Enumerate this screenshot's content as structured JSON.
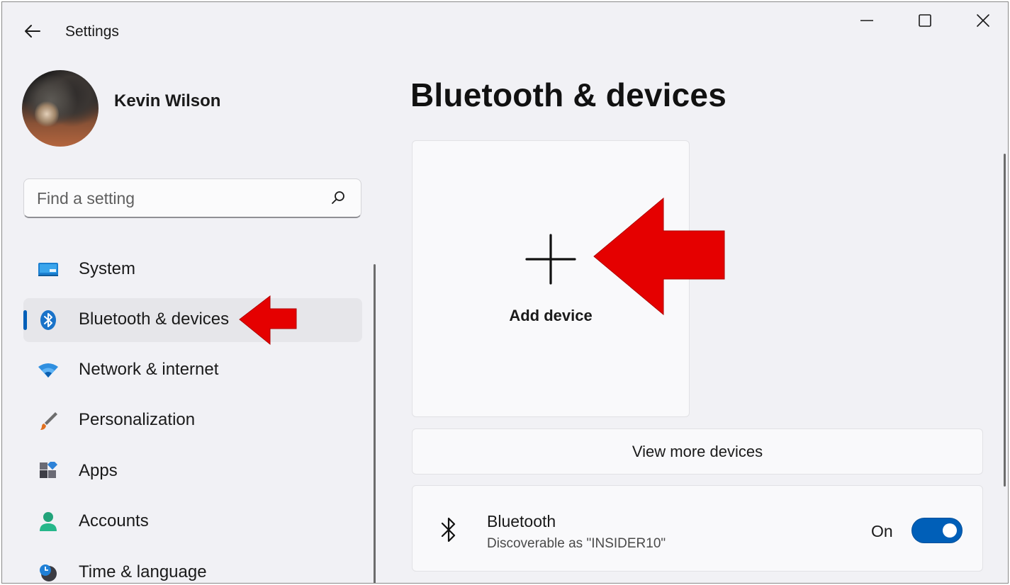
{
  "window": {
    "app_title": "Settings",
    "controls": [
      "minimize",
      "maximize",
      "close"
    ]
  },
  "profile": {
    "name": "Kevin Wilson"
  },
  "search": {
    "placeholder": "Find a setting",
    "value": ""
  },
  "sidebar": {
    "items": [
      {
        "label": "System",
        "icon": "system-icon",
        "active": false
      },
      {
        "label": "Bluetooth & devices",
        "icon": "bluetooth-icon",
        "active": true
      },
      {
        "label": "Network & internet",
        "icon": "wifi-icon",
        "active": false
      },
      {
        "label": "Personalization",
        "icon": "brush-icon",
        "active": false
      },
      {
        "label": "Apps",
        "icon": "apps-icon",
        "active": false
      },
      {
        "label": "Accounts",
        "icon": "accounts-icon",
        "active": false
      },
      {
        "label": "Time & language",
        "icon": "clock-globe-icon",
        "active": false
      }
    ]
  },
  "main": {
    "title": "Bluetooth & devices",
    "add_device_label": "Add device",
    "view_more_label": "View more devices",
    "bluetooth": {
      "title": "Bluetooth",
      "subtitle": "Discoverable as \"INSIDER10\"",
      "state_label": "On",
      "enabled": true
    }
  },
  "annotations": {
    "arrow_color": "#e50000"
  },
  "colors": {
    "accent": "#005fb8",
    "background": "#f1f1f5",
    "card": "#f9f9fb"
  }
}
